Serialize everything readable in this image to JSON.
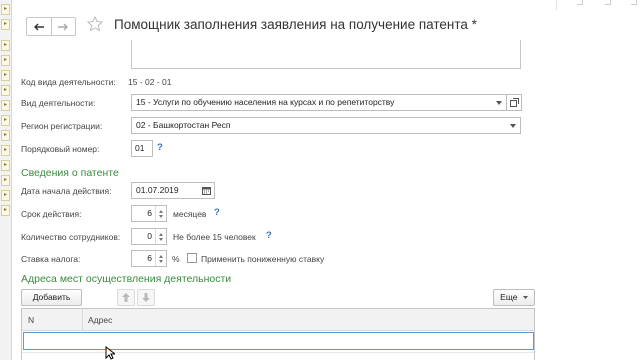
{
  "header": {
    "title": "Помощник заполнения заявления на получение патента *"
  },
  "activity_code": {
    "label": "Код вида деятельности:",
    "value": "15 - 02 - 01"
  },
  "activity_type": {
    "label": "Вид деятельности:",
    "value": "15 - Услуги по обучению населения на курсах и по репетиторству"
  },
  "region": {
    "label": "Регион регистрации:",
    "value": "02 - Башкортостан Респ"
  },
  "serial": {
    "label": "Порядковый номер:",
    "value": "01",
    "help": "?"
  },
  "patent_section": {
    "title": "Сведения о патенте",
    "start_date": {
      "label": "Дата начала действия:",
      "value": "01.07.2019"
    },
    "duration": {
      "label": "Срок действия:",
      "value": "6",
      "unit": "месяцев",
      "help": "?"
    },
    "employees": {
      "label": "Количество сотрудников:",
      "value": "0",
      "note": "Не более 15 человек",
      "help": "?"
    },
    "tax_rate": {
      "label": "Ставка налога:",
      "value": "6",
      "unit": "%",
      "reduced_rate_label": "Применить пониженную ставку",
      "reduced_rate_checked": false
    }
  },
  "addresses_section": {
    "title": "Адреса мест осуществления деятельности",
    "add_button": "Добавить",
    "more_button": "Еще",
    "columns": [
      "N",
      "Адрес"
    ]
  },
  "edge_tabs": [
    "▸",
    "▸",
    "▸",
    "▸",
    "▸",
    "▸",
    "▸",
    "▸",
    "▸",
    "▸",
    "▸",
    "▸",
    "▸",
    "▸"
  ],
  "colors": {
    "section_green": "#3a8a3f",
    "help_blue": "#3b6fb6",
    "selection_blue": "#5a9bd5"
  }
}
